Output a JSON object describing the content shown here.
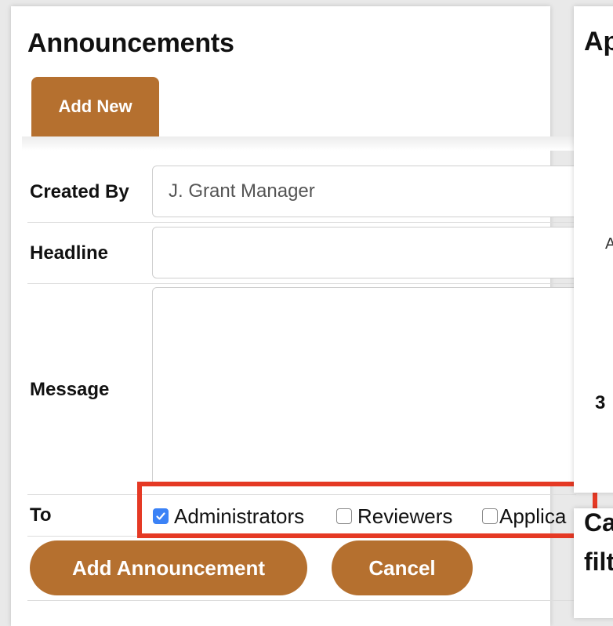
{
  "page": {
    "title": "Announcements",
    "add_new_tab": "Add New"
  },
  "form": {
    "created_by": {
      "label": "Created By",
      "value": "J. Grant Manager"
    },
    "headline": {
      "label": "Headline",
      "value": ""
    },
    "message": {
      "label": "Message",
      "value": ""
    },
    "to": {
      "label": "To",
      "options": [
        {
          "label": "Administrators",
          "checked": true
        },
        {
          "label": "Reviewers",
          "checked": false
        },
        {
          "label": "Applica",
          "checked": false
        }
      ]
    }
  },
  "actions": {
    "add_announcement": "Add Announcement",
    "cancel": "Cancel"
  },
  "right_panel": {
    "title_fragment": "Ap",
    "small_text": "A",
    "number": "3",
    "bottom_line1": "Ca",
    "bottom_line2": "filt"
  },
  "colors": {
    "accent": "#b5702f",
    "highlight": "#e53924",
    "checkbox_checked": "#3b82f6"
  }
}
